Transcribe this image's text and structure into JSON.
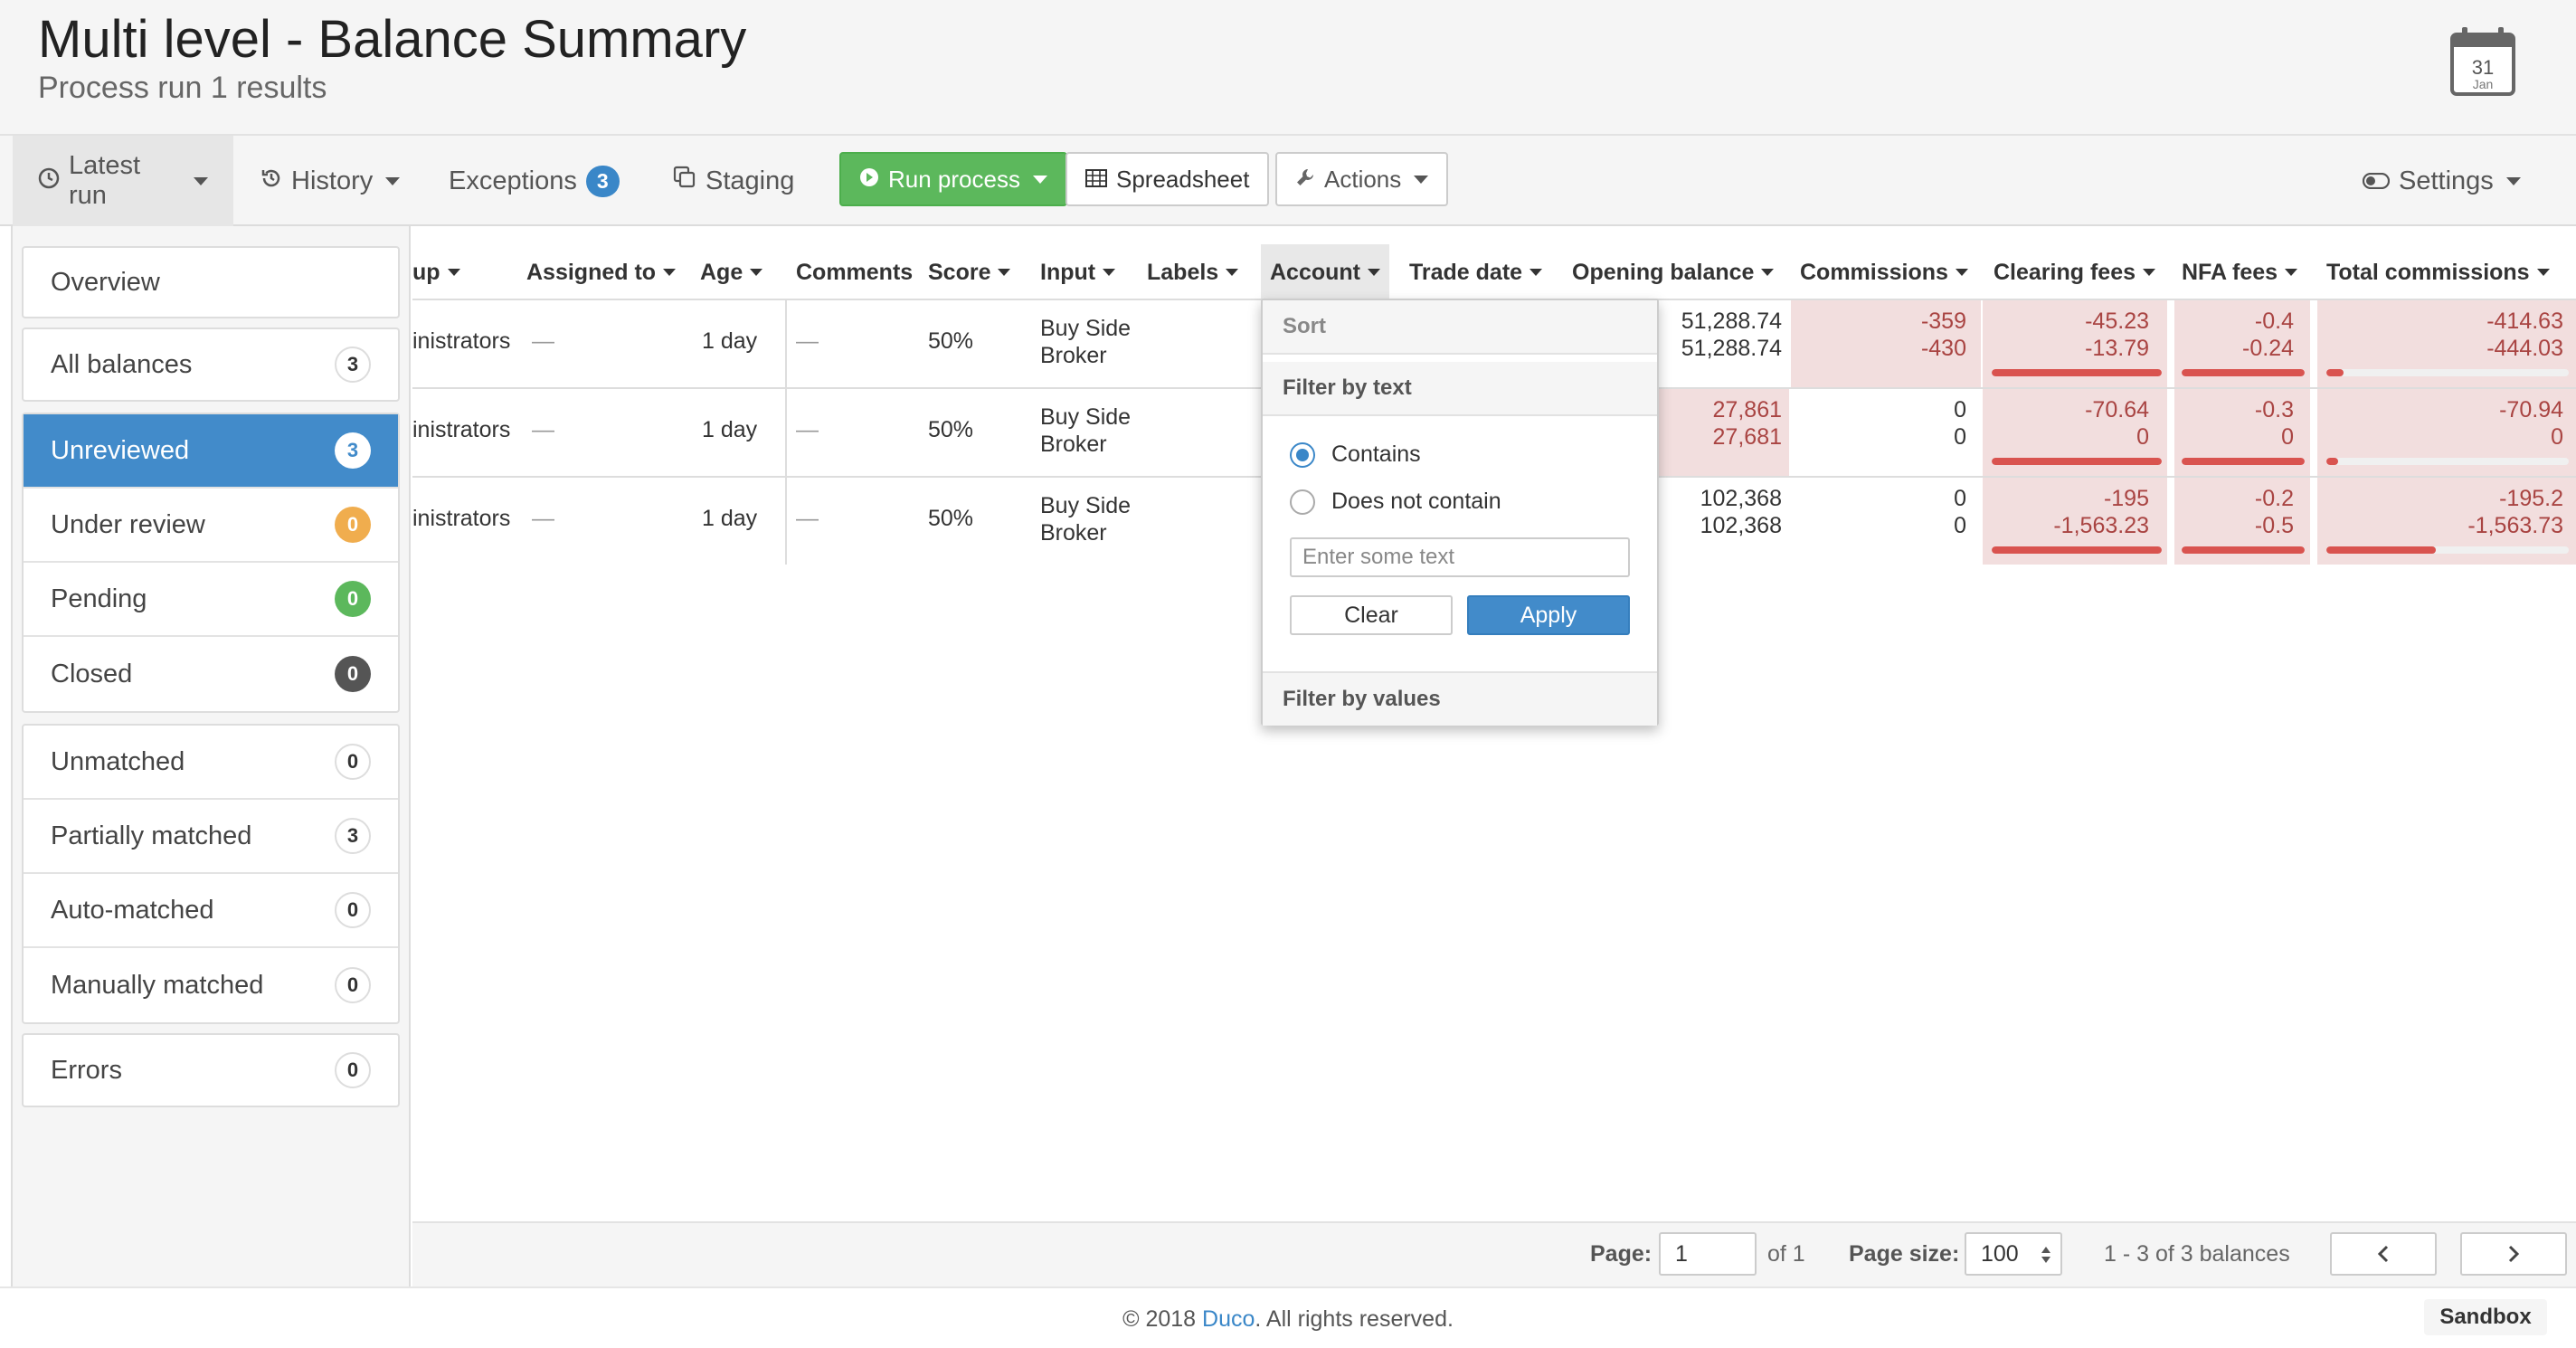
{
  "header": {
    "title": "Multi level - Balance Summary",
    "subtitle": "Process run 1 results",
    "calendar_day": "31",
    "calendar_month": "Jan"
  },
  "toolbar": {
    "latest_run": "Latest run",
    "history": "History",
    "exceptions": "Exceptions",
    "exceptions_count": "3",
    "staging": "Staging",
    "run_process": "Run process",
    "spreadsheet": "Spreadsheet",
    "actions": "Actions",
    "settings": "Settings"
  },
  "sidebar": {
    "overview": "Overview",
    "all_balances": {
      "label": "All balances",
      "count": "3"
    },
    "status": [
      {
        "label": "Unreviewed",
        "count": "3"
      },
      {
        "label": "Under review",
        "count": "0"
      },
      {
        "label": "Pending",
        "count": "0"
      },
      {
        "label": "Closed",
        "count": "0"
      }
    ],
    "match": [
      {
        "label": "Unmatched",
        "count": "0"
      },
      {
        "label": "Partially matched",
        "count": "3"
      },
      {
        "label": "Auto-matched",
        "count": "0"
      },
      {
        "label": "Manually matched",
        "count": "0"
      }
    ],
    "errors": {
      "label": "Errors",
      "count": "0"
    }
  },
  "table": {
    "headers": {
      "group_partial": "up",
      "assigned_to": "Assigned to",
      "age": "Age",
      "comments": "Comments",
      "score": "Score",
      "input": "Input",
      "labels": "Labels",
      "account": "Account",
      "trade_date": "Trade date",
      "opening_balance": "Opening balance",
      "commissions": "Commissions",
      "clearing_fees": "Clearing fees",
      "nfa_fees": "NFA fees",
      "total_commissions": "Total commissions"
    },
    "rows": [
      {
        "group": "inistrators",
        "assigned": "—",
        "age": "1 day",
        "comments": "—",
        "score": "50%",
        "input_line1": "Buy Side",
        "input_line2": "Broker",
        "opening": [
          "51,288.74",
          "51,288.74"
        ],
        "commissions": [
          "-359",
          "-430"
        ],
        "clearing": [
          "-45.23",
          "-13.79"
        ],
        "nfa": [
          "-0.4",
          "-0.24"
        ],
        "total": [
          "-414.63",
          "-444.03"
        ],
        "clearing_fill": 1.0,
        "nfa_fill": 1.0,
        "total_fill": 0.07
      },
      {
        "group": "inistrators",
        "assigned": "—",
        "age": "1 day",
        "comments": "—",
        "score": "50%",
        "input_line1": "Buy Side",
        "input_line2": "Broker",
        "opening": [
          "27,861",
          "27,681"
        ],
        "commissions": [
          "0",
          "0"
        ],
        "clearing": [
          "-70.64",
          "0"
        ],
        "nfa": [
          "-0.3",
          "0"
        ],
        "total": [
          "-70.94",
          "0"
        ],
        "clearing_fill": 1.0,
        "nfa_fill": 1.0,
        "total_fill": 0.05
      },
      {
        "group": "inistrators",
        "assigned": "—",
        "age": "1 day",
        "comments": "—",
        "score": "50%",
        "input_line1": "Buy Side",
        "input_line2": "Broker",
        "opening": [
          "102,368",
          "102,368"
        ],
        "commissions": [
          "0",
          "0"
        ],
        "clearing": [
          "-195",
          "-1,563.23"
        ],
        "nfa": [
          "-0.2",
          "-0.5"
        ],
        "total": [
          "-195.2",
          "-1,563.73"
        ],
        "clearing_fill": 1.0,
        "nfa_fill": 1.0,
        "total_fill": 0.45
      }
    ]
  },
  "filter_dropdown": {
    "sort": "Sort",
    "filter_by_text": "Filter by text",
    "contains": "Contains",
    "does_not_contain": "Does not contain",
    "placeholder": "Enter some text",
    "clear": "Clear",
    "apply": "Apply",
    "filter_by_values": "Filter by values"
  },
  "pager": {
    "page_label": "Page:",
    "page_value": "1",
    "of_pages": "of 1",
    "page_size_label": "Page size:",
    "page_size_value": "100",
    "range_text": "1 - 3 of 3 balances",
    "prev": "‹",
    "next": "›"
  },
  "footer": {
    "copyright_prefix": "© 2018 ",
    "brand": "Duco",
    "copyright_suffix": ". All rights reserved.",
    "sandbox": "Sandbox"
  },
  "colors": {
    "primary": "#428bca",
    "success": "#5cb85c",
    "warning": "#f0ad4e",
    "danger": "#d9534f",
    "negative_bg": "#f2dede"
  }
}
